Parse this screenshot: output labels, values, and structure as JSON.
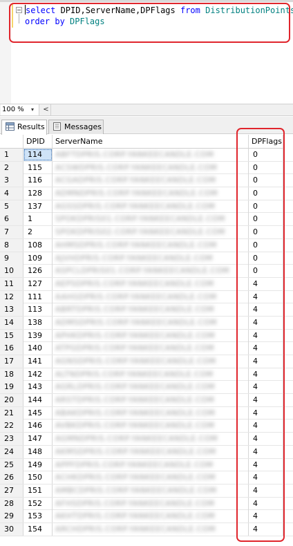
{
  "editor": {
    "line1": {
      "kw1": "select",
      "cols": " DPID,ServerName,DPFlags ",
      "kw2": "from",
      "table": " DistributionPoints"
    },
    "line2": {
      "kw": "order by",
      "col": " DPFlags"
    },
    "highlight_color": "#e0252c"
  },
  "toolbar": {
    "zoom": "100 %",
    "zoom_caret": "▾",
    "scroll_left": "<"
  },
  "tabs": [
    {
      "label": "Results",
      "icon": "grid-icon"
    },
    {
      "label": "Messages",
      "icon": "messages-icon"
    }
  ],
  "grid": {
    "columns": [
      "DPID",
      "ServerName",
      "DPFlags"
    ],
    "rows": [
      {
        "n": "1",
        "dpid": "114",
        "server": "ABFTDPRIS.CORP.YANKEECANDLE.COM",
        "flags": "0"
      },
      {
        "n": "2",
        "dpid": "115",
        "server": "ACSWDPRIS.CORP.YANKEECANDLE.COM",
        "flags": "0"
      },
      {
        "n": "3",
        "dpid": "116",
        "server": "ACGADPRIS.CORP.YANKEECANDLE.COM",
        "flags": "0"
      },
      {
        "n": "4",
        "dpid": "128",
        "server": "ADMNDPRIS.CORP.YANKEECANDLE.COM",
        "flags": "0"
      },
      {
        "n": "5",
        "dpid": "137",
        "server": "AGSSDPRIS.CORP.YANKEECANDLE.COM",
        "flags": "0"
      },
      {
        "n": "6",
        "dpid": "1",
        "server": "SPOKDPRIS01.CORP.YANKEECANDLE.COM",
        "flags": "0"
      },
      {
        "n": "7",
        "dpid": "2",
        "server": "SPOKDPRIS02.CORP.YANKEECANDLE.COM",
        "flags": "0"
      },
      {
        "n": "8",
        "dpid": "108",
        "server": "AHMSDPRIS.CORP.YANKEECANDLE.COM",
        "flags": "0"
      },
      {
        "n": "9",
        "dpid": "109",
        "server": "AJVHDPRIS.CORP.YANKEECANDLE.COM",
        "flags": "0"
      },
      {
        "n": "10",
        "dpid": "126",
        "server": "ASPCLDPRIS01.CORP.YANKEECANDLE.COM",
        "flags": "0"
      },
      {
        "n": "11",
        "dpid": "127",
        "server": "AEPSDPRIS.CORP.YANKEECANDLE.COM",
        "flags": "4"
      },
      {
        "n": "12",
        "dpid": "111",
        "server": "AAHGDPRIS.CORP.YANKEECANDLE.COM",
        "flags": "4"
      },
      {
        "n": "13",
        "dpid": "113",
        "server": "ABRTDPRIS.CORP.YANKEECANDLE.COM",
        "flags": "4"
      },
      {
        "n": "14",
        "dpid": "138",
        "server": "ADMSDPRIS.CORP.YANKEECANDLE.COM",
        "flags": "4"
      },
      {
        "n": "15",
        "dpid": "139",
        "server": "APHKDPRIS.CORP.YANKEECANDLE.COM",
        "flags": "4"
      },
      {
        "n": "16",
        "dpid": "140",
        "server": "ATPGDPRIS.CORP.YANKEECANDLE.COM",
        "flags": "4"
      },
      {
        "n": "17",
        "dpid": "141",
        "server": "AGNSDPRIS.CORP.YANKEECANDLE.COM",
        "flags": "4"
      },
      {
        "n": "18",
        "dpid": "142",
        "server": "ALTNDPRIS.CORP.YANKEECANDLE.COM",
        "flags": "4"
      },
      {
        "n": "19",
        "dpid": "143",
        "server": "AGRLDPRIS.CORP.YANKEECANDLE.COM",
        "flags": "4"
      },
      {
        "n": "20",
        "dpid": "144",
        "server": "ARSTDPRIS.CORP.YANKEECANDLE.COM",
        "flags": "4"
      },
      {
        "n": "21",
        "dpid": "145",
        "server": "ABAKDPRIS.CORP.YANKEECANDLE.COM",
        "flags": "4"
      },
      {
        "n": "22",
        "dpid": "146",
        "server": "AVBKDPRIS.CORP.YANKEECANDLE.COM",
        "flags": "4"
      },
      {
        "n": "23",
        "dpid": "147",
        "server": "AGMNDPRIS.CORP.YANKEECANDLE.COM",
        "flags": "4"
      },
      {
        "n": "24",
        "dpid": "148",
        "server": "AKMSDPRIS.CORP.YANKEECANDLE.COM",
        "flags": "4"
      },
      {
        "n": "25",
        "dpid": "149",
        "server": "APPFDPRIS.CORP.YANKEECANDLE.COM",
        "flags": "4"
      },
      {
        "n": "26",
        "dpid": "150",
        "server": "ACHKDPRIS.CORP.YANKEECANDLE.COM",
        "flags": "4"
      },
      {
        "n": "27",
        "dpid": "151",
        "server": "AMBCDPRIS.CORP.YANKEECANDLE.COM",
        "flags": "4"
      },
      {
        "n": "28",
        "dpid": "152",
        "server": "AFHSDPRIS.CORP.YANKEECANDLE.COM",
        "flags": "4"
      },
      {
        "n": "29",
        "dpid": "153",
        "server": "AKHTDPRIS.CORP.YANKEECANDLE.COM",
        "flags": "4"
      },
      {
        "n": "30",
        "dpid": "154",
        "server": "ARCHDPRIS.CORP.YANKEECANDLE.COM",
        "flags": "4"
      }
    ]
  }
}
